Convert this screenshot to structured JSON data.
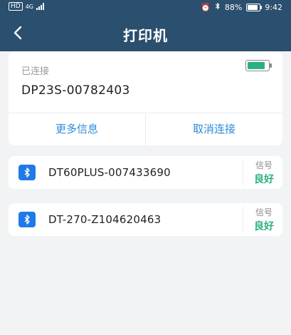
{
  "status_bar": {
    "network_badge": "HD",
    "network_type": "4G",
    "battery_percent": "88%",
    "battery_level": 0.88,
    "time": "9:42"
  },
  "header": {
    "title": "打印机"
  },
  "connected": {
    "label": "已连接",
    "device_name": "DP23S-00782403",
    "battery_level": 0.85,
    "battery_color": "#2bb07f",
    "more_info_button": "更多信息",
    "disconnect_button": "取消连接"
  },
  "printers": [
    {
      "name": "DT60PLUS-007433690",
      "signal_label": "信号",
      "signal_value": "良好"
    },
    {
      "name": "DT-270-Z104620463",
      "signal_label": "信号",
      "signal_value": "良好"
    }
  ],
  "colors": {
    "header_bg": "#2b4f6e",
    "accent_blue": "#2d8ad9",
    "bluetooth_blue": "#1f7ae8",
    "signal_green": "#2bb07f"
  }
}
